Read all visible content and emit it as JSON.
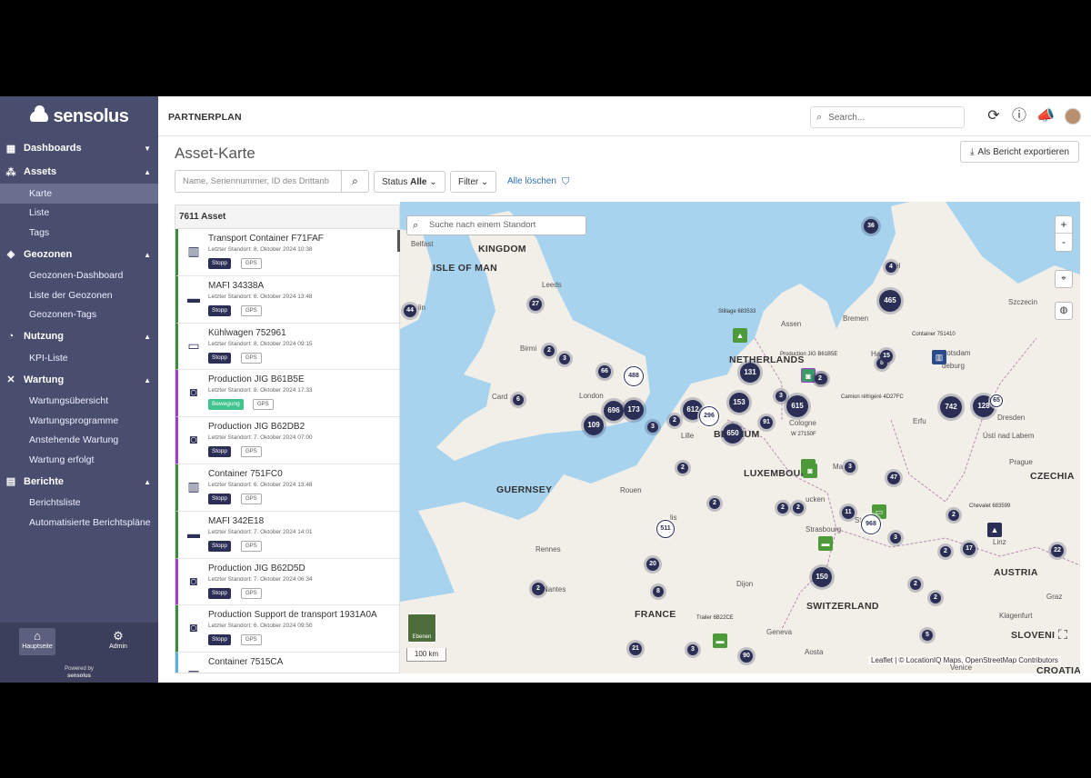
{
  "app": {
    "logo": "sensolus",
    "org": "PARTNERPLAN",
    "search_placeholder": "Search...",
    "powered_by": "Powered by",
    "powered_logo": "sensolus"
  },
  "sidebar": {
    "dashboards": "Dashboards",
    "assets": "Assets",
    "assets_items": [
      "Karte",
      "Liste",
      "Tags"
    ],
    "geozones": "Geozonen",
    "geozones_items": [
      "Geozonen-Dashboard",
      "Liste der Geozonen",
      "Geozonen-Tags"
    ],
    "usage": "Nutzung",
    "usage_items": [
      "KPI-Liste"
    ],
    "maintenance": "Wartung",
    "maintenance_items": [
      "Wartungsübersicht",
      "Wartungsprogramme",
      "Anstehende Wartung",
      "Wartung erfolgt"
    ],
    "reports": "Berichte",
    "reports_items": [
      "Berichtsliste",
      "Automatisierte Berichtspläne"
    ],
    "home": "Hauptseite",
    "admin": "Admin"
  },
  "main": {
    "title": "Asset-Karte",
    "export": "Als Bericht exportieren",
    "asset_search_placeholder": "Name, Seriennummer, ID des Drittanb",
    "status_label": "Status",
    "status_value": "Alle",
    "filter": "Filter",
    "clear_all": "Alle löschen"
  },
  "list": {
    "count": "7611 Asset",
    "gps": "GPS",
    "items": [
      {
        "name": "Transport Container F71FAF",
        "loc": "Letzter Standort: 8. Oktober 2024 10:38",
        "state": "Stopp"
      },
      {
        "name": "MAFI 34338A",
        "loc": "Letzter Standort: 6. Oktober 2024 13:48",
        "state": "Stopp"
      },
      {
        "name": "Kühlwagen 752961",
        "loc": "Letzter Standort: 8. Oktober 2024 09:15",
        "state": "Stopp"
      },
      {
        "name": "Production JIG B61B5E",
        "loc": "Letzter Standort: 8. Oktober 2024 17:33",
        "state": "Bewegung"
      },
      {
        "name": "Production JIG B62DB2",
        "loc": "Letzter Standort: 7. Oktober 2024 07:00",
        "state": "Stopp"
      },
      {
        "name": "Container 751FC0",
        "loc": "Letzter Standort: 6. Oktober 2024 13:48",
        "state": "Stopp"
      },
      {
        "name": "MAFI 342E18",
        "loc": "Letzter Standort: 7. Oktober 2024 14:01",
        "state": "Stopp"
      },
      {
        "name": "Production JIG B62D5D",
        "loc": "Letzter Standort: 7. Oktober 2024 06:34",
        "state": "Stopp"
      },
      {
        "name": "Production Support de transport 1931A0A",
        "loc": "Letzter Standort: 6. Oktober 2024 09:50",
        "state": "Stopp"
      },
      {
        "name": "Container 7515CA",
        "loc": "",
        "state": ""
      }
    ]
  },
  "map": {
    "search_placeholder": "Suche nach einem Standort",
    "zoom_in": "+",
    "zoom_out": "-",
    "layers": "Ebenen",
    "scale": "100 km",
    "attribution": "Leaflet | © LocationIQ Maps, OpenStreetMap Contributors",
    "countries": [
      "KINGDOM",
      "ISLE OF MAN",
      "NETHERLANDS",
      "BELGIUM",
      "LUXEMBOURG",
      "GUERNSEY",
      "FRANCE",
      "SWITZERLAND",
      "CZECHIA",
      "AUSTRIA",
      "SLOVENI"
    ],
    "cities": [
      "Belfast",
      "Leeds",
      "Birmi",
      "Card",
      "London",
      "Rouen",
      "Rennes",
      "Nantes",
      "Dijon",
      "Geneva",
      "Aosta",
      "Lille",
      "Cologne",
      "Erfu",
      "Dresden",
      "Ústí nad Labem",
      "Prague",
      "Linz",
      "Graz",
      "Klagenfurt",
      "Strasbourg",
      "Bremen",
      "Potsdam",
      "Szczecin",
      "Assen",
      "Kiel",
      "lin",
      "St",
      "Ma",
      "ucken",
      "lis",
      "Ha",
      "deburg",
      "Venice",
      "CROATIA"
    ],
    "asset_tags": [
      "Stillage 683533",
      "Production JIG B61B5E",
      "Camion réfrigéré 4D27FC",
      "Container 751410",
      "W 27150F",
      "Chevalet 683599",
      "Trailer 6B22CE"
    ],
    "clusters": [
      "36",
      "4",
      "27",
      "465",
      "131",
      "2",
      "3",
      "2",
      "44",
      "6",
      "3",
      "8",
      "66",
      "488",
      "615",
      "742",
      "128",
      "65",
      "612",
      "153",
      "696",
      "173",
      "296",
      "3",
      "2",
      "91",
      "650",
      "109",
      "3",
      "2",
      "2",
      "47",
      "511",
      "20",
      "2",
      "2",
      "11",
      "968",
      "3",
      "2",
      "17",
      "22",
      "150",
      "2",
      "2",
      "8",
      "2",
      "5",
      "21",
      "3",
      "90",
      "2",
      "15",
      "2"
    ]
  }
}
